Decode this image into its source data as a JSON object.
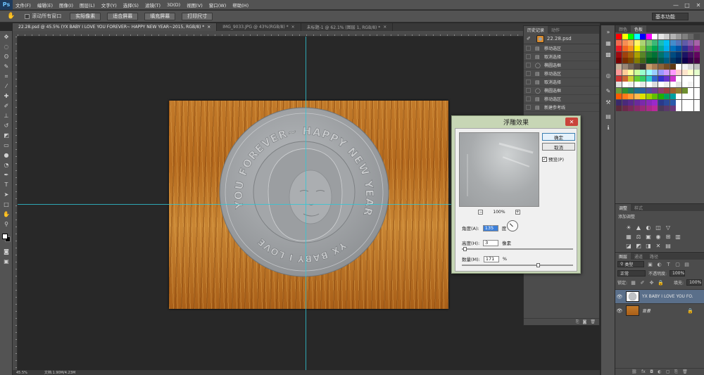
{
  "app": {
    "logo": "Ps",
    "menu": [
      "文件(F)",
      "编辑(E)",
      "图像(I)",
      "图层(L)",
      "文字(Y)",
      "选择(S)",
      "滤镜(T)",
      "3D(D)",
      "视图(V)",
      "窗口(W)",
      "帮助(H)"
    ],
    "window_controls": [
      "—",
      "□",
      "✕"
    ]
  },
  "options_bar": {
    "scroll_all_label": "滚动所有窗口",
    "buttons": [
      "实际像素",
      "适合屏幕",
      "填充屏幕",
      "打印尺寸"
    ],
    "workspace": "基本功能"
  },
  "tabs": [
    {
      "label": "22.28.psd @ 45.5% (YX BABY I LOVE YOU FOREVER~ HAPPY NEW YEAR~2015, RGB/8) *",
      "active": true
    },
    {
      "label": "IMG_9033.JPG @ 43%(RGB/8) *",
      "active": false
    },
    {
      "label": "未标题-1 @ 62.1% (图层 1, RGB/8) *",
      "active": false
    }
  ],
  "coin": {
    "text_top": "YOU FOREVER~ HAPPY NEW YEAR~2015",
    "text_bottom": "YX BABY I LOVE"
  },
  "dialog": {
    "title": "浮雕效果",
    "close": "✕",
    "ok": "确定",
    "cancel": "取消",
    "preview_label": "预览(P)",
    "preview_checked": "✓",
    "zoom_minus": "−",
    "zoom": "100%",
    "zoom_plus": "+",
    "angle_label": "角度(A):",
    "angle_value": "135",
    "angle_unit": "度",
    "height_label": "高度(H):",
    "height_value": "3",
    "height_unit": "像素",
    "amount_label": "数量(M):",
    "amount_value": "171",
    "amount_unit": "%",
    "height_slider_level": 0.02,
    "amount_slider_level": 0.68
  },
  "history": {
    "tabs": [
      "历史记录",
      "动作"
    ],
    "snapshot": "22.28.psd",
    "items": [
      "移动选区",
      "取消选择",
      "椭圆选框",
      "移动选区",
      "取消选择",
      "椭圆选框",
      "移动选区",
      "新建参考线"
    ],
    "item_icons": [
      "▤",
      "▤",
      "◯",
      "▤",
      "▤",
      "◯",
      "▤",
      "▤"
    ],
    "footer": [
      "⎘",
      "◙",
      "🗑"
    ]
  },
  "swatches": {
    "tabs": [
      "颜色",
      "色板"
    ],
    "colors": [
      "#ff0000",
      "#ffff00",
      "#00ff00",
      "#00ffff",
      "#0000ff",
      "#ff00ff",
      "#ffffff",
      "#e6e6e6",
      "#cccccc",
      "#b3b3b3",
      "#999999",
      "#808080",
      "#666666",
      "#4d4d4d",
      "#f26c4f",
      "#f68e55",
      "#fbaf5d",
      "#fff568",
      "#acd373",
      "#7cc576",
      "#3bb878",
      "#1abbb4",
      "#00bff3",
      "#438ccb",
      "#5574b9",
      "#605ca8",
      "#855fa8",
      "#a763a8",
      "#ed1c24",
      "#f26522",
      "#f7941d",
      "#fff200",
      "#8dc73f",
      "#39b54a",
      "#00a651",
      "#00a99d",
      "#00aeef",
      "#0072bc",
      "#0054a6",
      "#2e3192",
      "#662d91",
      "#92278f",
      "#9e0b0f",
      "#a0410d",
      "#a3620a",
      "#aba000",
      "#598527",
      "#197b30",
      "#007236",
      "#00746b",
      "#0076a3",
      "#004b80",
      "#003471",
      "#1b1464",
      "#440e62",
      "#630460",
      "#790000",
      "#7b2e00",
      "#7d4900",
      "#827b00",
      "#406618",
      "#005e20",
      "#005826",
      "#005952",
      "#005b7f",
      "#003663",
      "#002157",
      "#0d004c",
      "#32004b",
      "#4b0049",
      "#c7b299",
      "#998675",
      "#736357",
      "#534741",
      "#37302d",
      "#c69c6d",
      "#a67c52",
      "#8c6239",
      "#754c24",
      "#603913",
      "#ffffff",
      "#f2f2f2",
      "#d9d9d9",
      "#bfbfbf",
      "#ff9999",
      "#ffcc99",
      "#ffff99",
      "#ccff99",
      "#99ffcc",
      "#99ffff",
      "#99ccff",
      "#9999ff",
      "#cc99ff",
      "#ff99ff",
      "#ffcccc",
      "#ffe5cc",
      "#ffffcc",
      "#e5ffcc",
      "#cc3333",
      "#cc6633",
      "#cccc33",
      "#66cc33",
      "#33cc66",
      "#33cccc",
      "#3366cc",
      "#3333cc",
      "#6633cc",
      "#cc33cc",
      "#ffffff",
      "#ffffff",
      "#ffffff",
      "#ffffff",
      "#e0e0e0",
      "#ffffff",
      "#f0f0f0",
      "#ffffff",
      "#e8e8e8",
      "#ffffff",
      "#dcdcdc",
      "#ffffff",
      "#ececec",
      "#ffffff",
      "#e4e4e4",
      "#ffffff",
      "#f4f4f4",
      "#ffffff",
      "#6b9b3a",
      "#2f8f2f",
      "#1f7f5f",
      "#1f6f8f",
      "#2f5f9f",
      "#4f4f9f",
      "#6f3f8f",
      "#8f3f6f",
      "#9f3f3f",
      "#9f5f2f",
      "#8f7f2f",
      "#6f8f2f",
      "#ffffff",
      "#ffffff",
      "#ff5a00",
      "#ff7a1a",
      "#ff9a33",
      "#ffba4d",
      "#e0e000",
      "#a0d000",
      "#60c000",
      "#20b000",
      "#00a060",
      "#00a0a0",
      "#ffffff",
      "#ffffff",
      "#ffffff",
      "#ffffff",
      "#3a2a6a",
      "#4a2a7a",
      "#5a2a8a",
      "#6a2a9a",
      "#7a2aaa",
      "#8a2aba",
      "#9a2aca",
      "#2a3a8a",
      "#2a4a9a",
      "#2a5aaa",
      "#ffffff",
      "#ffffff",
      "#ffffff",
      "#ffffff",
      "#5a2a3a",
      "#6a2a4a",
      "#7a2a5a",
      "#8a2a6a",
      "#9a2a7a",
      "#aa2a8a",
      "#ba2a9a",
      "#4a3a5a",
      "#5a3a6a",
      "#6a3a7a",
      "#ffffff",
      "#ffffff",
      "#ffffff",
      "#ffffff"
    ]
  },
  "adjustments": {
    "tabs": [
      "调整",
      "样式"
    ],
    "label": "添加调整",
    "row1": [
      "☀",
      "▲",
      "◐",
      "◫",
      "▽"
    ],
    "row2": [
      "▦",
      "⚖",
      "▣",
      "◉",
      "⊞",
      "▥"
    ],
    "row3": [
      "◪",
      "◩",
      "◨",
      "✕",
      "▤"
    ]
  },
  "layers": {
    "tabs": [
      "图层",
      "通道",
      "路径"
    ],
    "filter": "类型",
    "blend": "正常",
    "opacity_label": "不透明度:",
    "opacity": "100%",
    "lock_label": "锁定:",
    "fill_label": "填充:",
    "fill": "100%",
    "items": [
      {
        "name": "YX BABY I LOVE YOU FO...",
        "selected": true
      },
      {
        "name": "背景",
        "selected": false,
        "locked": true
      }
    ],
    "footer": [
      "⛓",
      "fx",
      "◘",
      "◐",
      "▢",
      "⎘",
      "🗑"
    ]
  },
  "status": {
    "zoom": "45.5%",
    "doc": "文档:1.90M/4.23M"
  },
  "colors": {
    "guide": "#2fc7d6",
    "wood": "#c27a2a",
    "dialog_frame": "#c7d6b5",
    "close_button": "#c9443a"
  }
}
